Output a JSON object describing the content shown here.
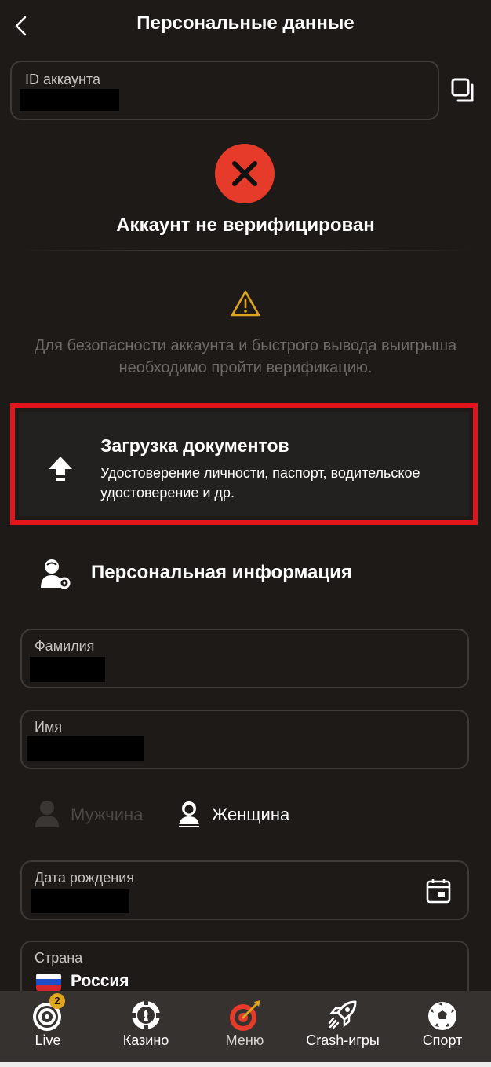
{
  "header": {
    "title": "Персональные данные",
    "back_icon": "chevron-left-icon"
  },
  "account": {
    "id_label": "ID аккаунта",
    "copy_icon": "copy-icon"
  },
  "status": {
    "icon": "error-x-icon",
    "text": "Аккаунт не верифицирован",
    "color": "#e63a2a"
  },
  "warning": {
    "icon": "warning-triangle-icon",
    "text": "Для безопасности аккаунта и быстрого вывода выигрыша необходимо пройти верификацию."
  },
  "upload": {
    "icon": "upload-arrow-icon",
    "title": "Загрузка документов",
    "subtitle": "Удостоверение личности, паспорт, водительское удостоверение и др."
  },
  "personal_info": {
    "heading": "Персональная информация",
    "icon": "user-settings-icon",
    "surname_label": "Фамилия",
    "name_label": "Имя",
    "gender": {
      "male": "Мужчина",
      "female": "Женщина",
      "selected": "Женщина"
    },
    "birthdate_label": "Дата рождения",
    "calendar_icon": "calendar-icon",
    "country_label": "Страна",
    "country_value": "Россия"
  },
  "bottom_nav": [
    {
      "label": "Live",
      "icon": "target-icon",
      "badge": "2"
    },
    {
      "label": "Казино",
      "icon": "casino-chip-icon"
    },
    {
      "label": "Меню",
      "icon": "dart-target-icon"
    },
    {
      "label": "Crash-игры",
      "icon": "rocket-icon"
    },
    {
      "label": "Спорт",
      "icon": "soccer-ball-icon"
    }
  ],
  "colors": {
    "background": "#1d1a18",
    "accent_red": "#e63a2a",
    "warning_yellow": "#e0a51f",
    "highlight_border": "#e2141c"
  }
}
